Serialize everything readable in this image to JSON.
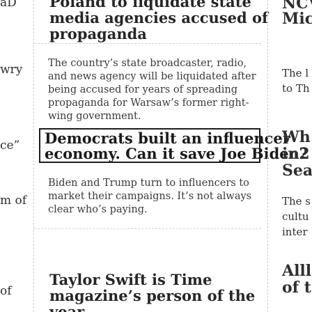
{
  "left_column": {
    "fragments": [
      "aD",
      "wry",
      "ce”",
      "m of",
      "of"
    ]
  },
  "right_column": {
    "fragments": [
      "NCV",
      "Mic",
      "The l",
      "to Th",
      "Wh",
      "in2",
      "Sea",
      "The s",
      "cultu",
      "inter",
      "Alll",
      "of t"
    ]
  },
  "articles": [
    {
      "headline": "Poland to liquidate state media agencies accused of propaganda",
      "summary": ""
    },
    {
      "headline": "",
      "summary": "The country’s state broadcaster, radio, and news agency will be liquidated after being accused for years of spreading propaganda for Warsaw’s former right-wing government."
    },
    {
      "headline": "Democrats built an influencer economy. Can it save Joe Biden?",
      "summary": "Biden and Trump turn to influencers to market their campaigns. It’s not always clear who’s paying."
    },
    {
      "headline": "Taylor Swift is Time magazine’s person of the year",
      "summary": ""
    }
  ],
  "highlight": {
    "line1": "Democrats built an influencer",
    "line2": "economy. Can it save Joe Biden?"
  }
}
